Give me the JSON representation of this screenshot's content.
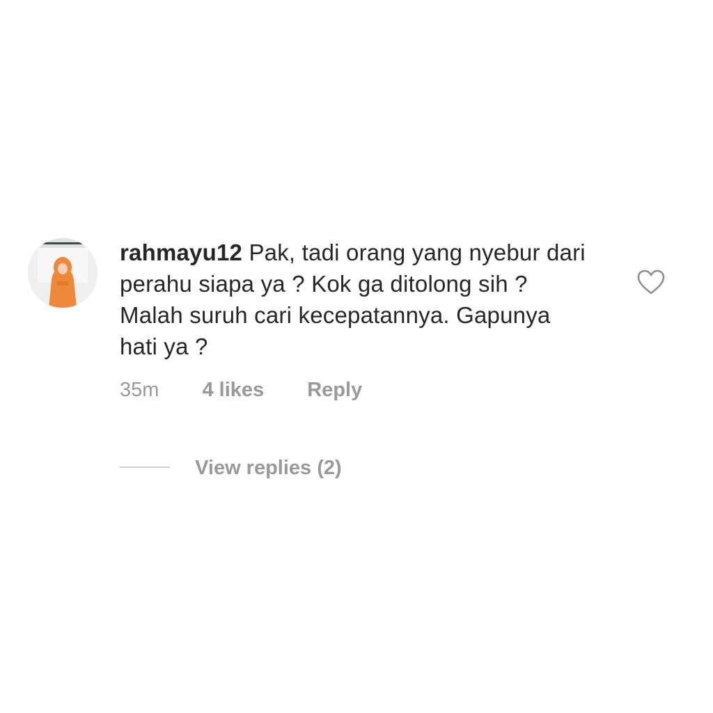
{
  "comment": {
    "username": "rahmayu12",
    "text": "Pak, tadi orang yang nyebur dari perahu siapa ya ? Kok ga ditolong sih ? Malah suruh cari kecepatannya. Gapunya hati ya ?",
    "time": "35m",
    "likes": "4 likes",
    "reply_label": "Reply",
    "view_replies": "View replies (2)",
    "liked": false
  },
  "icons": {
    "like": "heart-outline-icon",
    "avatar": "profile-photo"
  },
  "colors": {
    "text_primary": "#262626",
    "text_secondary": "#999999",
    "divider": "#cfcfcf",
    "background": "#ffffff",
    "avatar_accent": "#f0883a"
  }
}
